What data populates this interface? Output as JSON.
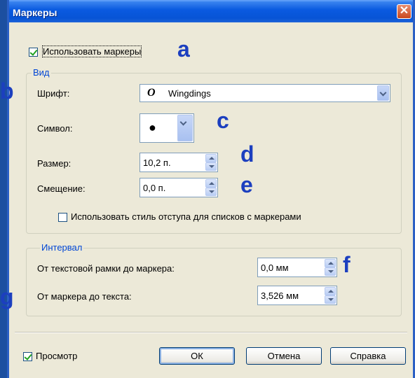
{
  "window": {
    "title": "Маркеры",
    "close_glyph": "✕"
  },
  "use_markers": {
    "label": "Использовать маркеры",
    "checked": true
  },
  "view_group": {
    "legend": "Вид",
    "font": {
      "label": "Шрифт:",
      "glyph": "O",
      "value": "Wingdings"
    },
    "symbol": {
      "label": "Символ:",
      "value": "●"
    },
    "size": {
      "label": "Размер:",
      "value": "10,2 п."
    },
    "offset": {
      "label": "Смещение:",
      "value": "0,0 п."
    },
    "indent_style": {
      "label": "Использовать стиль отступа для списков с маркерами",
      "checked": false
    }
  },
  "interval_group": {
    "legend": "Интервал",
    "frame_to_marker": {
      "label": "От текстовой рамки до маркера:",
      "value": "0,0 мм"
    },
    "marker_to_text": {
      "label": "От маркера до текста:",
      "value": "3,526 мм"
    }
  },
  "preview": {
    "label": "Просмотр",
    "checked": true
  },
  "buttons": {
    "ok": "ОК",
    "cancel": "Отмена",
    "help": "Справка"
  },
  "annotations": {
    "a": "a",
    "b": "b",
    "c": "c",
    "d": "d",
    "e": "e",
    "f": "f",
    "g": "g"
  },
  "colors": {
    "title_bar": "#0754d6",
    "dialog_bg": "#ece9d8",
    "annotation": "#1c3fbf",
    "legend": "#0046d5"
  }
}
